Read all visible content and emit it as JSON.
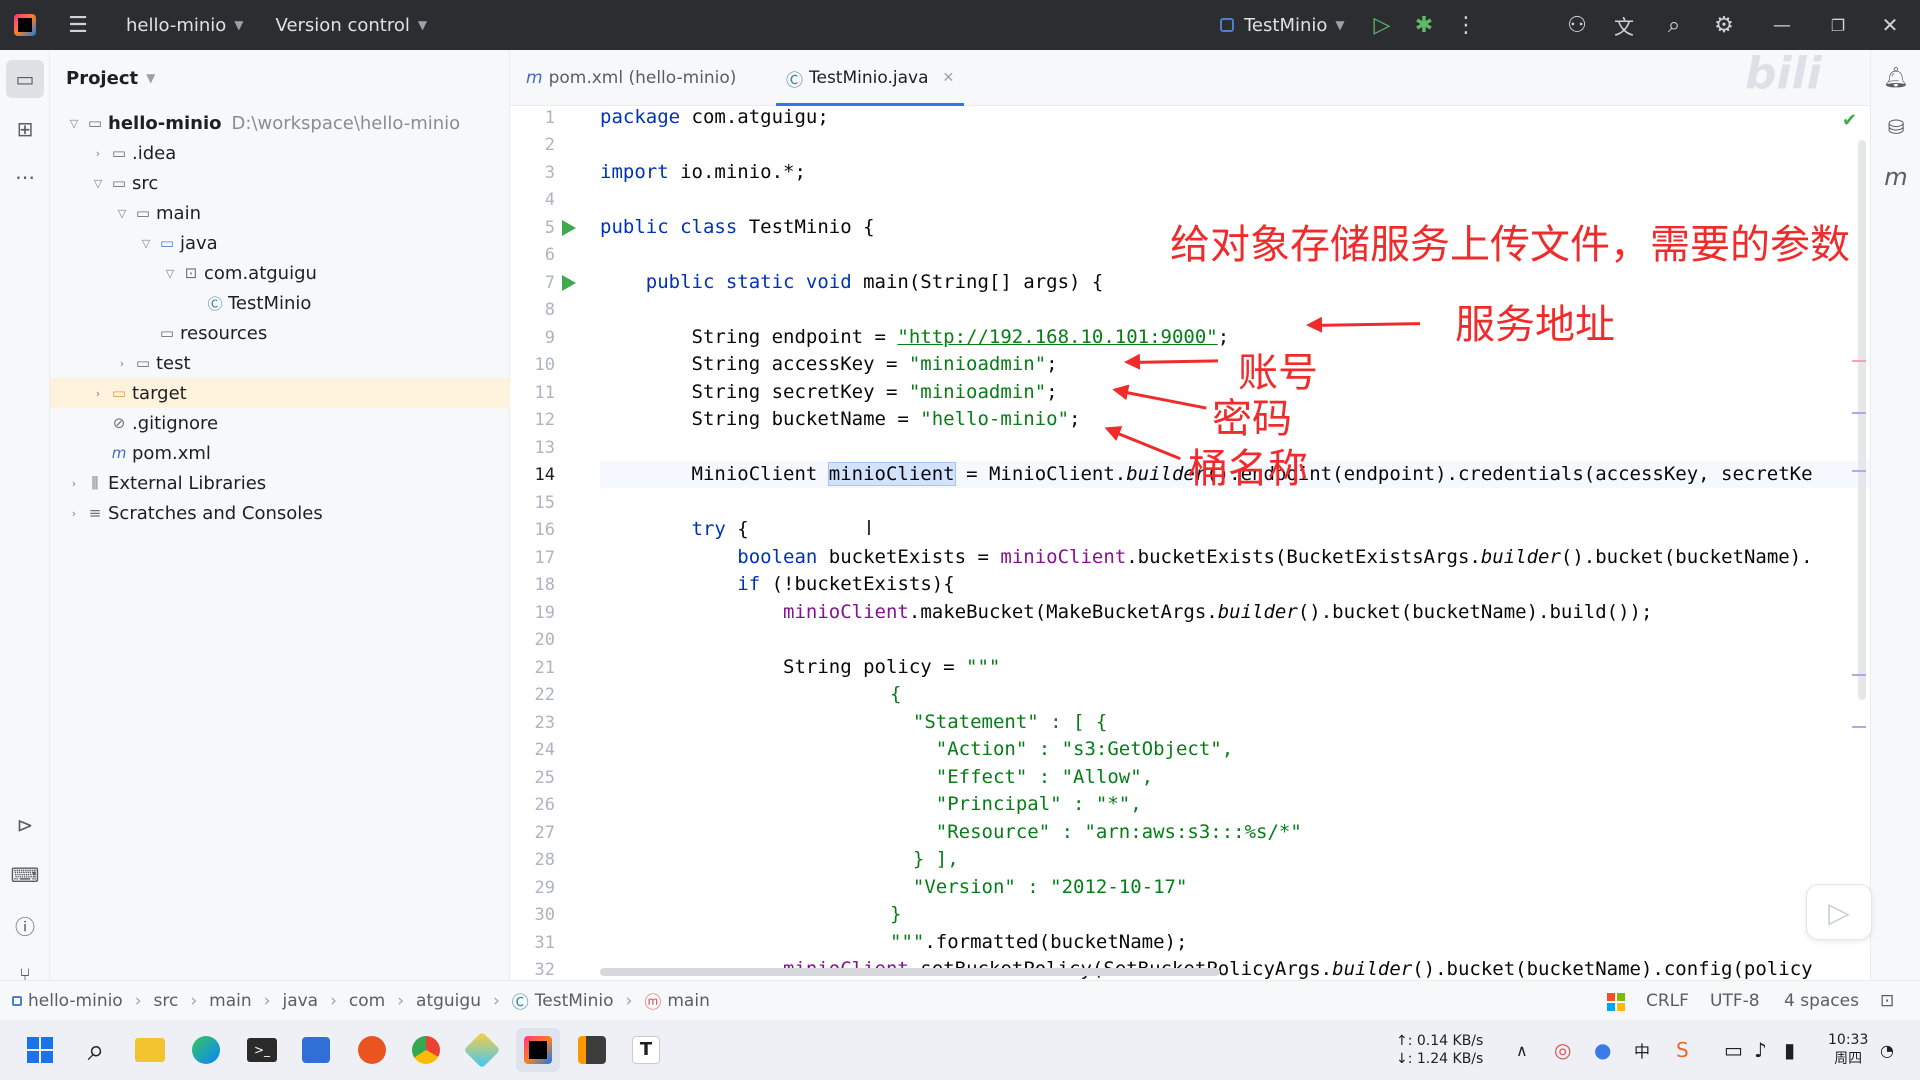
{
  "titlebar": {
    "project_name": "hello-minio",
    "vcs_label": "Version control",
    "run_config": "TestMinio"
  },
  "project_panel": {
    "title": "Project",
    "root_name": "hello-minio",
    "root_path": "D:\\workspace\\hello-minio",
    "items": [
      {
        "label": ".idea"
      },
      {
        "label": "src"
      },
      {
        "label": "main"
      },
      {
        "label": "java"
      },
      {
        "label": "com.atguigu"
      },
      {
        "label": "TestMinio"
      },
      {
        "label": "resources"
      },
      {
        "label": "test"
      },
      {
        "label": "target"
      },
      {
        "label": ".gitignore"
      },
      {
        "label": "pom.xml"
      },
      {
        "label": "External Libraries"
      },
      {
        "label": "Scratches and Consoles"
      }
    ]
  },
  "tabs": [
    {
      "label": "pom.xml (hello-minio)"
    },
    {
      "label": "TestMinio.java"
    }
  ],
  "editor": {
    "line_numbers": [
      "1",
      "2",
      "3",
      "4",
      "5",
      "6",
      "7",
      "8",
      "9",
      "10",
      "11",
      "12",
      "13",
      "14",
      "15",
      "16",
      "17",
      "18",
      "19",
      "20",
      "21",
      "22",
      "23",
      "24",
      "25",
      "26",
      "27",
      "28",
      "29",
      "30",
      "31",
      "32"
    ],
    "lines": {
      "l1_kw": "package",
      "l1_rest": " com.atguigu;",
      "l3_kw": "import",
      "l3_rest": " io.minio.*;",
      "l5_kw": "public class",
      "l5_rest": " TestMinio {",
      "l7_kw": "public static void",
      "l7_rest": " main(String[] args) {",
      "l9_pre": "        String endpoint = ",
      "l9_str": "\"http://192.168.10.101:9000\"",
      "l9_end": ";",
      "l10_pre": "        String accessKey = ",
      "l10_str": "\"minioadmin\"",
      "l10_end": ";",
      "l11_pre": "        String secretKey = ",
      "l11_str": "\"minioadmin\"",
      "l11_end": ";",
      "l12_pre": "        String bucketName = ",
      "l12_str": "\"hello-minio\"",
      "l12_end": ";",
      "l14_pre": "        MinioClient ",
      "l14_sel": "minioClient",
      "l14_mid": " = MinioClient.",
      "l14_it": "builder",
      "l14_end": "().endpoint(endpoint).credentials(accessKey, secretKe",
      "l16_kw": "try",
      "l16_rest": " {",
      "l17_kw": "boolean",
      "l17_mid": " bucketExists = ",
      "l17_fld": "minioClient",
      "l17_a": ".bucketExists(BucketExistsArgs.",
      "l17_it": "builder",
      "l17_end": "().bucket(bucketName).",
      "l18_kw": "if",
      "l18_rest": " (!bucketExists){",
      "l19_fld": "minioClient",
      "l19_a": ".makeBucket(MakeBucketArgs.",
      "l19_it": "builder",
      "l19_end": "().bucket(bucketName).build());",
      "l21_pre": "                String policy = ",
      "l21_str": "\"\"\"",
      "l22": "{",
      "l23": "  \"Statement\" : [ {",
      "l24": "    \"Action\" : \"s3:GetObject\",",
      "l25": "    \"Effect\" : \"Allow\",",
      "l26": "    \"Principal\" : \"*\",",
      "l27": "    \"Resource\" : \"arn:aws:s3:::%s/*\"",
      "l28": "  } ],",
      "l29": "  \"Version\" : \"2012-10-17\"",
      "l30": "}",
      "l31_str": "\"\"\"",
      "l31_rest": ".formatted(bucketName);",
      "l32_fld": "minioClient",
      "l32_a": ".setBucketPolicy(SetBucketPolicyArgs.",
      "l32_it": "builder",
      "l32_end": "().bucket(bucketName).config(policy"
    }
  },
  "annotations": {
    "heading": "给对象存储服务上传文件，需要的参数",
    "endpoint": "服务地址",
    "account": "账号",
    "password": "密码",
    "bucket": "桶名称"
  },
  "breadcrumb": [
    "hello-minio",
    "src",
    "main",
    "java",
    "com",
    "atguigu",
    "TestMinio",
    "main"
  ],
  "status": {
    "line_sep": "CRLF",
    "encoding": "UTF-8",
    "indent": "4 spaces"
  },
  "taskbar": {
    "net_up": "↑: 0.14 KB/s",
    "net_down": "↓: 1.24 KB/s",
    "time": "10:33",
    "day": "周四"
  },
  "colors": {
    "accent": "#3574f0",
    "annotation": "#ef2b2b",
    "run_green": "#3fa94d"
  }
}
